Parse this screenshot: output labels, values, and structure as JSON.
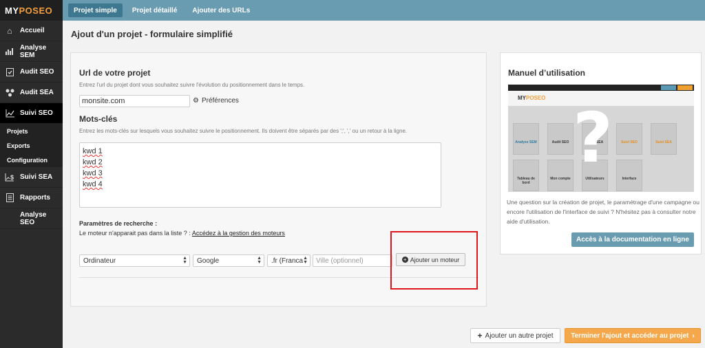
{
  "brand": {
    "part1": "MY",
    "part2": "POSEO"
  },
  "sidebar": {
    "items": [
      {
        "label": "Accueil",
        "icon": "home-icon"
      },
      {
        "label": "Analyse SEM",
        "icon": "bar-chart-icon"
      },
      {
        "label": "Audit SEO",
        "icon": "clipboard-check-icon"
      },
      {
        "label": "Audit SEA",
        "icon": "molecule-icon"
      },
      {
        "label": "Suivi SEO",
        "icon": "trend-chart-icon"
      }
    ],
    "sub_items": [
      "Projets",
      "Exports",
      "Configuration"
    ],
    "items2": [
      {
        "label": "Suivi SEA",
        "icon": "dollar-trend-icon"
      },
      {
        "label": "Rapports",
        "icon": "document-icon"
      },
      {
        "label": "Analyse SEO",
        "icon": ""
      }
    ]
  },
  "tabs": [
    "Projet simple",
    "Projet détaillé",
    "Ajouter des URLs"
  ],
  "page_title": "Ajout d'un projet - formulaire simplifié",
  "form": {
    "url_title": "Url de votre projet",
    "url_hint": "Entrez l'url du projet dont vous souhaitez suivre l'évolution du positionnement dans le temps.",
    "url_value": "monsite.com",
    "preferences_label": "Préférences",
    "keywords_title": "Mots-clés",
    "keywords_hint": "Entrez les mots-clés sur lesquels vous souhaitez suivre le positionnement. Ils doivent être séparés par des ';', ',' ou un retour à la ligne.",
    "keywords": [
      "kwd 1",
      "kwd 2",
      "kwd 3",
      "kwd 4"
    ],
    "params_title": "Paramètres de recherche :",
    "params_text": "Le moteur n'apparait pas dans la liste ? :",
    "params_link": "Accédez à la gestion des moteurs",
    "device": "Ordinateur",
    "engine": "Google",
    "locale": ".fr (Franca",
    "city_placeholder": "Ville (optionnel)",
    "add_engine_label": "Ajouter un moteur"
  },
  "manual": {
    "title": "Manuel d’utilisation",
    "text": "Une question sur la création de projet, le paramétrage d'une campagne ou encore l'utilisation de l'interface de suivi ? N'hésitez pas à consulter notre aide d'utilisation.",
    "button": "Accès à la documentation en ligne",
    "preview": {
      "logo1": "MY",
      "logo2": "POSEO",
      "cards": [
        "Analyse SEM",
        "Audit SEO",
        "Audit SEA",
        "Suivi SEO",
        "Suivi SEA",
        "Tableau de bord",
        "Mon compte",
        "Utilisateurs",
        "Interface"
      ],
      "mark": "?"
    }
  },
  "footer": {
    "add_other": "Ajouter un autre projet",
    "finish": "Terminer l'ajout et accéder au projet"
  },
  "colors": {
    "accent": "#6a9cb1",
    "orange": "#f5a84b",
    "highlight": "#e0151c"
  }
}
